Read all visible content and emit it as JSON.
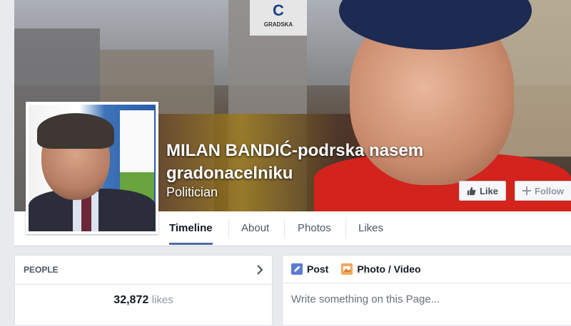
{
  "cover": {
    "badge_text": "C",
    "badge_sub": "GRADSKA"
  },
  "page": {
    "name": "MILAN BANDIĆ-podrska nasem gradonacelniku",
    "category": "Politician"
  },
  "actions": {
    "like_label": "Like",
    "follow_label": "Follow"
  },
  "nav": {
    "tabs": [
      {
        "label": "Timeline"
      },
      {
        "label": "About"
      },
      {
        "label": "Photos"
      },
      {
        "label": "Likes"
      }
    ]
  },
  "people": {
    "header": "PEOPLE",
    "likes_count": "32,872",
    "likes_label": "likes"
  },
  "composer": {
    "post_label": "Post",
    "photo_label": "Photo / Video",
    "placeholder": "Write something on this Page..."
  },
  "colors": {
    "accent": "#4e69a2",
    "background": "#e9eaed"
  }
}
